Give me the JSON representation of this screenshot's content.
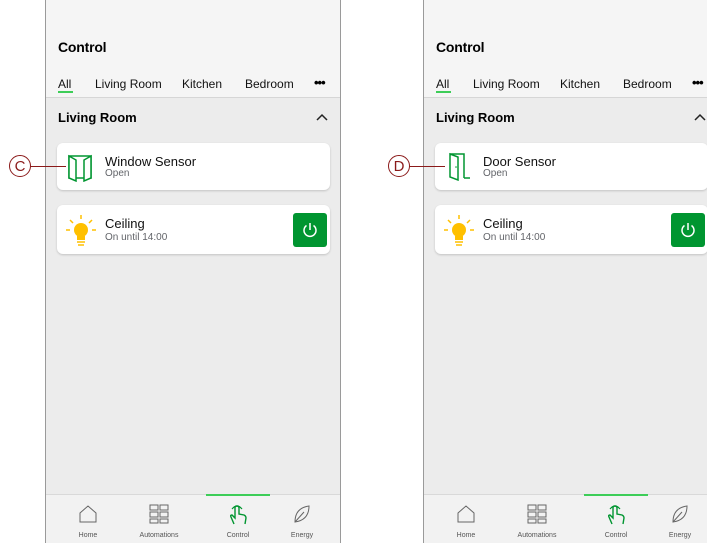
{
  "left_screen": {
    "title": "Control",
    "tabs": [
      "All",
      "Living Room",
      "Kitchen",
      "Bedroom"
    ],
    "more_label": "•••",
    "section_title": "Living Room",
    "sensor_card": {
      "name": "Window Sensor",
      "status": "Open",
      "icon": "window-sensor-icon"
    },
    "light_card": {
      "name": "Ceiling",
      "status": "On until 14:00",
      "icon": "light-bulb-icon"
    },
    "callout": "C"
  },
  "right_screen": {
    "title": "Control",
    "tabs": [
      "All",
      "Living Room",
      "Kitchen",
      "Bedroom"
    ],
    "more_label": "•••",
    "section_title": "Living Room",
    "sensor_card": {
      "name": "Door Sensor",
      "status": "Open",
      "icon": "door-sensor-icon"
    },
    "light_card": {
      "name": "Ceiling",
      "status": "On until 14:00",
      "icon": "light-bulb-icon"
    },
    "callout": "D"
  },
  "bottom_nav": [
    "Home",
    "Automations",
    "Control",
    "Energy"
  ],
  "active_nav": "Control",
  "colors": {
    "accent_green": "#3dcd58",
    "power_green": "#009530",
    "callout": "#8b1a1a",
    "bulb_yellow": "#ffc000"
  }
}
